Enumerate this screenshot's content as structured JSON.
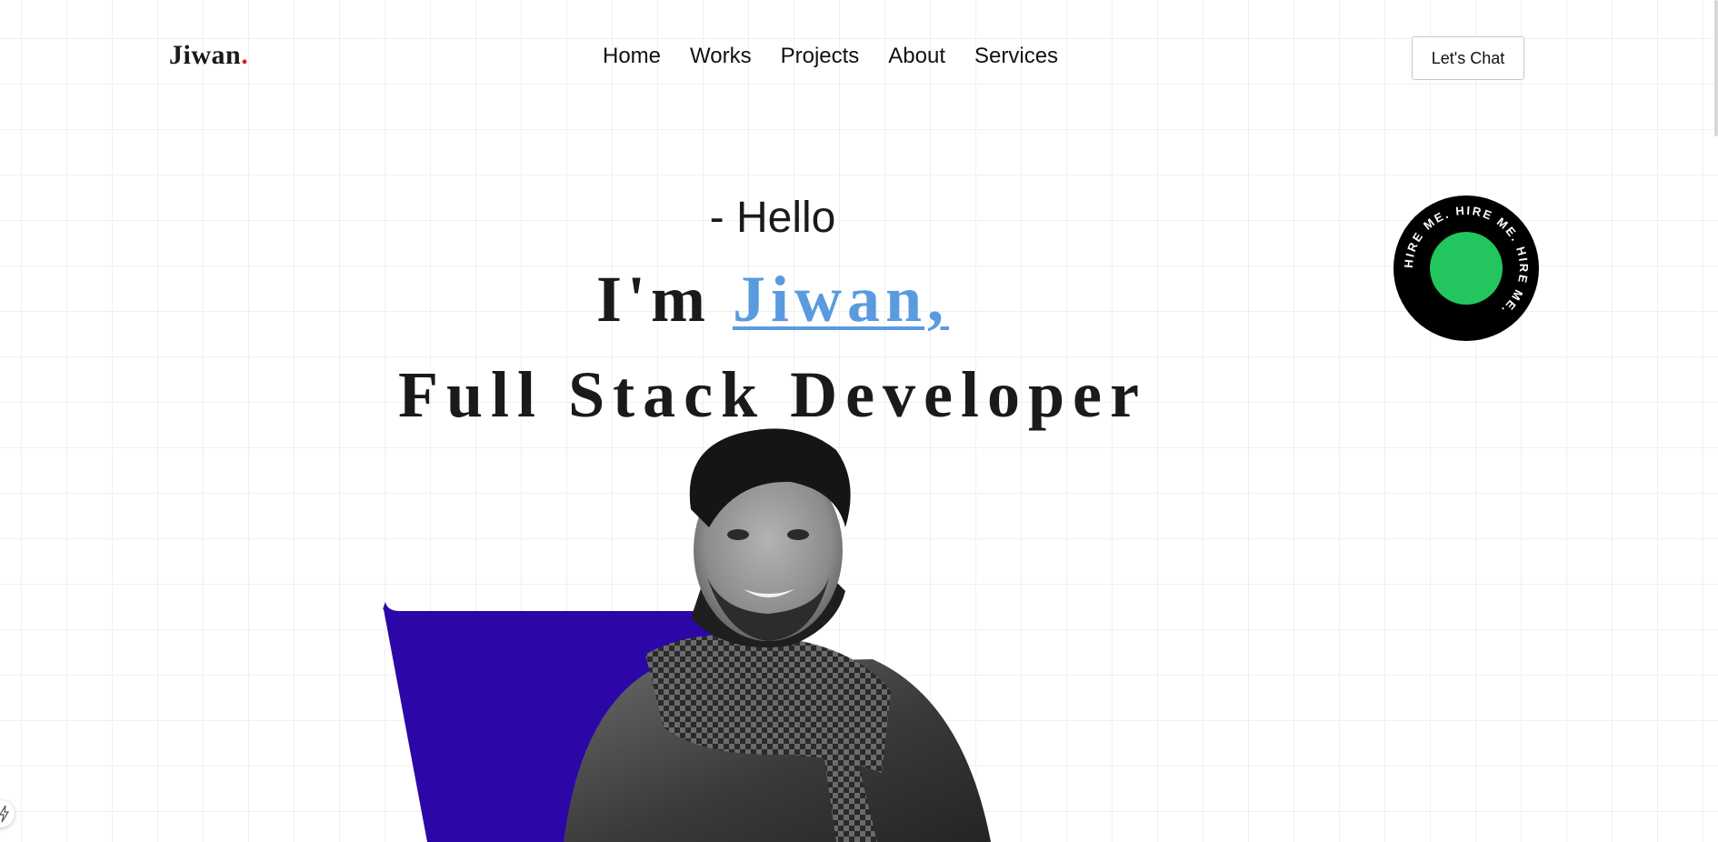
{
  "navbar": {
    "logo_text": "Jiwan",
    "logo_dot": ".",
    "links": [
      "Home",
      "Works",
      "Projects",
      "About",
      "Services"
    ],
    "cta_label": "Let's Chat"
  },
  "hero": {
    "greeting": "- Hello",
    "headline_prefix": "I'm ",
    "name": "Jiwan,",
    "role": "Full Stack Developer"
  },
  "hire_badge": {
    "text": "HIRE ME. HIRE ME. HIRE ME.",
    "ring_color": "#000000",
    "center_color": "#22c55e"
  },
  "colors": {
    "accent_name": "#5a9be0",
    "logo_dot": "#e11d2a",
    "portrait_backdrop": "#2d06a8",
    "grid_line": "#f0f0f0"
  },
  "icons": {
    "hire_badge": "rotating-text-badge",
    "side_tab": "lightning-icon"
  }
}
